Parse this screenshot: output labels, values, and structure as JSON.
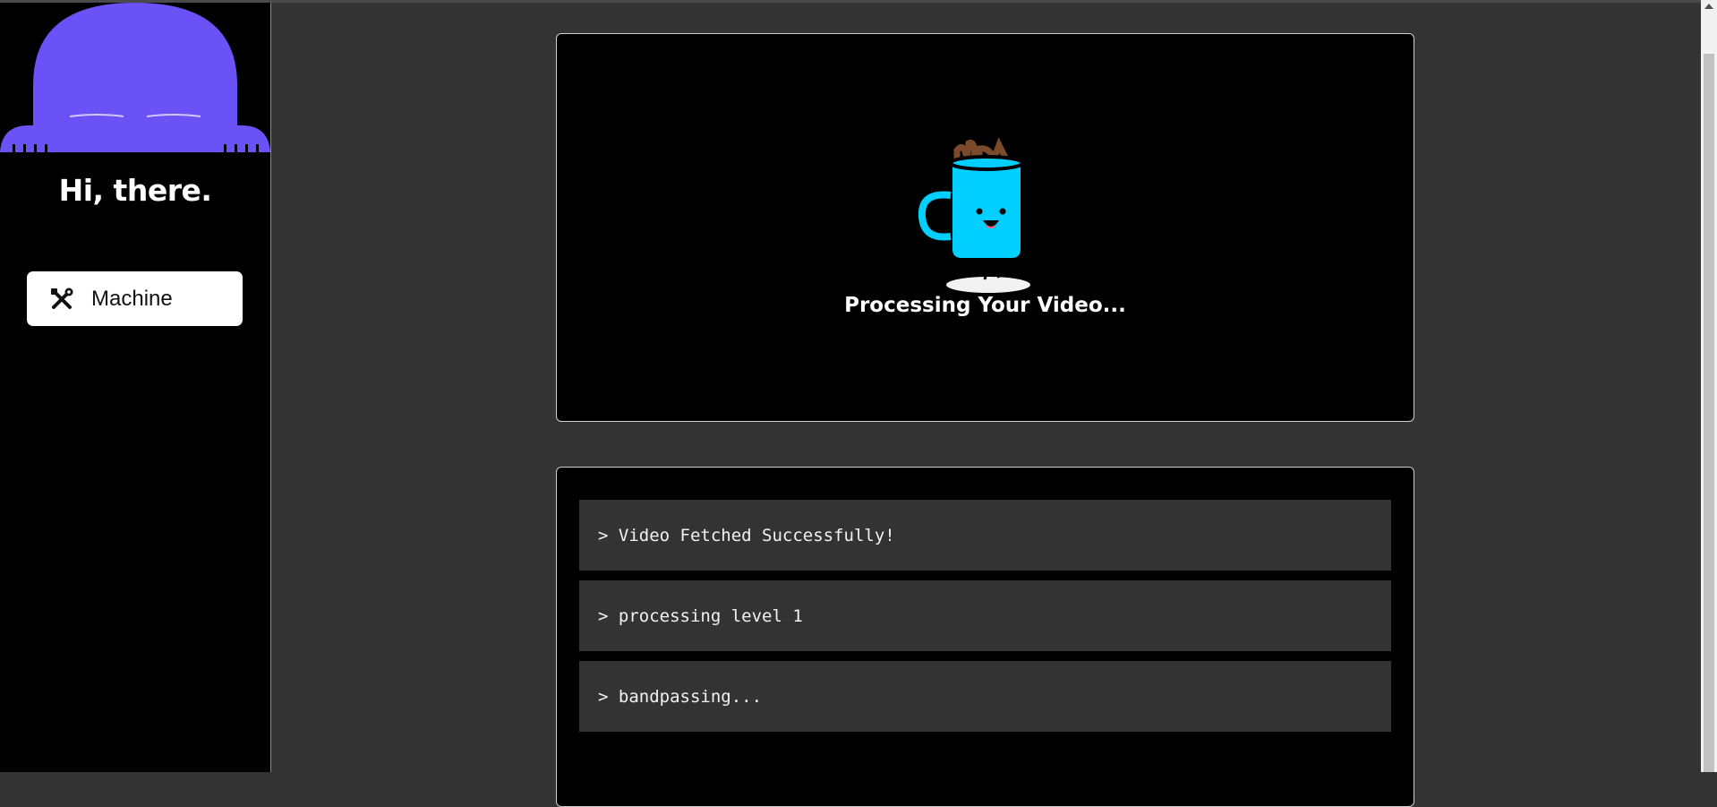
{
  "sidebar": {
    "greeting": "Hi, there.",
    "nav": [
      {
        "label": "Machine",
        "icon": "tools-icon"
      }
    ],
    "mascot_color": "#6a52f7"
  },
  "main": {
    "status_card": {
      "message": "Processing Your Video...",
      "illustration": "dancing-mug-illustration"
    },
    "log": [
      "> Video Fetched Successfully!",
      "> processing level 1",
      "> bandpassing..."
    ]
  },
  "colors": {
    "page_background": "#333333",
    "card_background": "#000000",
    "mug_color": "#00cfff",
    "log_row_background": "#333333"
  }
}
